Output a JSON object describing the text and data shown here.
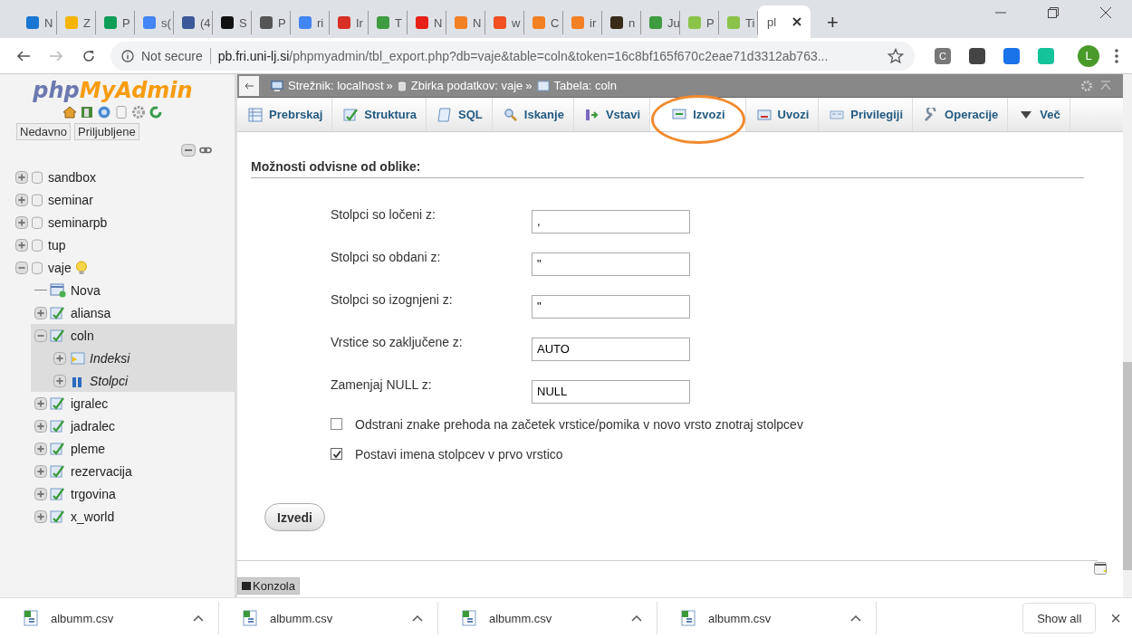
{
  "browser": {
    "tabs": [
      {
        "title": "N",
        "selected": false
      },
      {
        "title": "Z",
        "selected": false
      },
      {
        "title": "P",
        "selected": false
      },
      {
        "title": "s(",
        "selected": false
      },
      {
        "title": "(4",
        "selected": false
      },
      {
        "title": "S",
        "selected": false
      },
      {
        "title": "P",
        "selected": false
      },
      {
        "title": "ri",
        "selected": false
      },
      {
        "title": "Ir",
        "selected": false
      },
      {
        "title": "T",
        "selected": false
      },
      {
        "title": "N",
        "selected": false
      },
      {
        "title": "N",
        "selected": false
      },
      {
        "title": "w",
        "selected": false
      },
      {
        "title": "C",
        "selected": false
      },
      {
        "title": "ir",
        "selected": false
      },
      {
        "title": "n",
        "selected": false
      },
      {
        "title": "Ju",
        "selected": false
      },
      {
        "title": "P",
        "selected": false
      },
      {
        "title": "Ti",
        "selected": false
      },
      {
        "title": "pl",
        "selected": true
      }
    ],
    "new_tab": "+",
    "security": "Not secure",
    "url_host": "pb.fri.uni-lj.si",
    "url_path": "/phpmyadmin/tbl_export.php?db=vaje&table=coln&token=16c8bf165f670c2eae71d3312ab763...",
    "extensions": [
      {
        "label": "C",
        "color": "#777777"
      },
      {
        "color": "#444444"
      },
      {
        "color": "#1a73e8"
      },
      {
        "color": "#15c39a"
      }
    ],
    "profile": "L"
  },
  "sidebar": {
    "logo_a": "php",
    "logo_b": "MyAdmin",
    "tabs": [
      "Nedavno",
      "Priljubljene"
    ],
    "tree": [
      {
        "label": "sandbox",
        "kind": "database",
        "expanded": false,
        "selected": false
      },
      {
        "label": "seminar",
        "kind": "database",
        "expanded": false,
        "selected": false
      },
      {
        "label": "seminarpb",
        "kind": "database",
        "expanded": false,
        "selected": false
      },
      {
        "label": "tup",
        "kind": "database",
        "expanded": false,
        "selected": false
      },
      {
        "label": "vaje",
        "kind": "database",
        "expanded": true,
        "selected": false,
        "children": [
          {
            "label": "Nova",
            "kind": "new",
            "selected": false
          },
          {
            "label": "aliansa",
            "kind": "table",
            "expanded": false,
            "selected": false
          },
          {
            "label": "coln",
            "kind": "table",
            "expanded": true,
            "selected": true,
            "children": [
              {
                "label": "Indeksi",
                "kind": "index",
                "expanded": false
              },
              {
                "label": "Stolpci",
                "kind": "columns",
                "expanded": false
              }
            ]
          },
          {
            "label": "igralec",
            "kind": "table",
            "expanded": false,
            "selected": false
          },
          {
            "label": "jadralec",
            "kind": "table",
            "expanded": false,
            "selected": false
          },
          {
            "label": "pleme",
            "kind": "table",
            "expanded": false,
            "selected": false
          },
          {
            "label": "rezervacija",
            "kind": "table",
            "expanded": false,
            "selected": false
          },
          {
            "label": "trgovina",
            "kind": "table",
            "expanded": false,
            "selected": false
          },
          {
            "label": "x_world",
            "kind": "table",
            "expanded": false,
            "selected": false
          }
        ]
      }
    ]
  },
  "breadcrumb": [
    "Strežnik: localhost",
    "»",
    "Zbirka podatkov: vaje",
    "»",
    "Tabela: coln"
  ],
  "tabs": [
    {
      "label": "Prebrskaj",
      "selected": false
    },
    {
      "label": "Struktura",
      "selected": false
    },
    {
      "label": "SQL",
      "selected": false
    },
    {
      "label": "Iskanje",
      "selected": false
    },
    {
      "label": "Vstavi",
      "selected": false
    },
    {
      "label": "Izvozi",
      "selected": true,
      "circled": true
    },
    {
      "label": "Uvozi",
      "selected": false
    },
    {
      "label": "Privilegiji",
      "selected": false
    },
    {
      "label": "Operacije",
      "selected": false
    },
    {
      "label": "Več",
      "selected": false
    }
  ],
  "section_title": "Možnosti odvisne od oblike:",
  "fields": [
    {
      "label": "Stolpci so ločeni z:",
      "value": ","
    },
    {
      "label": "Stolpci so obdani z:",
      "value": "\""
    },
    {
      "label": "Stolpci so izognjeni z:",
      "value": "\""
    },
    {
      "label": "Vrstice so zaključene z:",
      "value": "AUTO"
    },
    {
      "label": "Zamenjaj NULL z:",
      "value": "NULL"
    }
  ],
  "checkboxes": [
    {
      "label": "Odstrani znake prehoda na začetek vrstice/pomika v novo vrsto znotraj stolpcev",
      "checked": false
    },
    {
      "label": "Postavi imena stolpcev v prvo vrstico",
      "checked": true
    }
  ],
  "submit": "Izvedi",
  "console": "Konzola",
  "downloads": [
    "albumm.csv",
    "albumm.csv",
    "albumm.csv",
    "albumm.csv"
  ],
  "show_all": "Show all",
  "close_downloads": "×"
}
